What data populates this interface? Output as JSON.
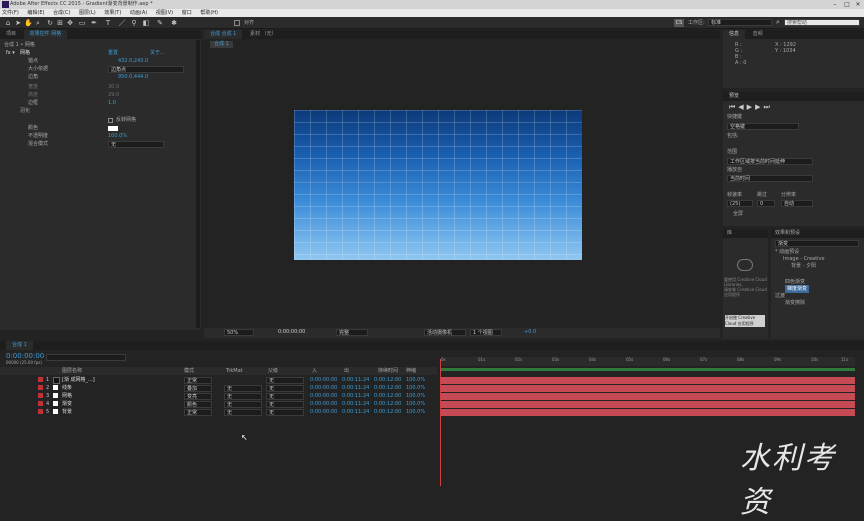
{
  "titlebar": {
    "title": "Adobe After Effects CC 2015 - Gradient渐变背景制作.aep *"
  },
  "menu": [
    "文件(F)",
    "编辑(E)",
    "合成(C)",
    "图层(L)",
    "效果(T)",
    "动画(A)",
    "视图(V)",
    "窗口",
    "帮助(H)"
  ],
  "toolbar": {
    "snap_label": "对齐",
    "workspace_label": "工作区:",
    "workspace_value": "标准",
    "search_placeholder": "搜索帮助"
  },
  "project_tabs": {
    "project": "项目",
    "effects": "效果控件 网格"
  },
  "effects": {
    "header": "合成 1 • 网格",
    "fx_name": "网格",
    "reset": "重置",
    "about": "关于...",
    "rows": [
      {
        "label": "锚点",
        "value": "432.0,243.0"
      },
      {
        "label": "大小依据",
        "value": "边角点"
      },
      {
        "label": "边角",
        "value": "950.0,444.0"
      },
      {
        "label": "宽度",
        "value": "30.0"
      },
      {
        "label": "高度",
        "value": "29.0"
      },
      {
        "label": "边框",
        "value": "1.0"
      },
      {
        "label": "羽化",
        "value": ""
      },
      {
        "label": "",
        "value": "反转网格"
      },
      {
        "label": "颜色",
        "value": ""
      },
      {
        "label": "不透明度",
        "value": "100.0%"
      },
      {
        "label": "混合模式",
        "value": "无"
      }
    ]
  },
  "comp": {
    "tabs": [
      "合成 合成 1",
      "素材 （无）"
    ],
    "breadcrumb": "合成 1",
    "zoom": "50%",
    "timecode": "0:00:00:00",
    "res": "完整",
    "camera": "活动摄像机",
    "view": "1 个视图",
    "exposure": "+0.0"
  },
  "info": {
    "tab1": "信息",
    "tab2": "音频",
    "lines": [
      "R :",
      "G :",
      "B :",
      "A : 0"
    ],
    "coords": [
      "X : 1292",
      "Y : 1034"
    ]
  },
  "preview": {
    "title": "预览",
    "shortcut_label": "快捷键",
    "shortcut_value": "空格键",
    "range_label": "包括:",
    "playmode_label": "范围",
    "playmode_value": "工作区域按当前时间延伸",
    "playfrom_label": "播放自",
    "playfrom_value": "当前时间",
    "fps_label": "帧速率",
    "skip_label": "跳过",
    "res_label": "分辨率",
    "fps_value": "(25)",
    "skip_value": "0",
    "res_value": "自动",
    "fullscreen": "全屏",
    "fx_label": "在回放后将时间设置为预览时间"
  },
  "library": {
    "tab": "库",
    "cc1": "要使用 Creative Cloud Libraries,",
    "cc2": "请安装 Creative Cloud 应用程序",
    "btn1": "开启使 Creative Cloud 应用程序"
  },
  "effects_presets": {
    "title": "效果和预设",
    "search": "渐变",
    "items": [
      "* 动画预设",
      "Image - Creative",
      "背景 - 夕阳",
      "四色渐变",
      "梯度渐变",
      "过渡",
      "渐变擦除"
    ]
  },
  "timeline": {
    "tab": "合成 1",
    "timecode": "0:00:00:00",
    "fps": "00000 (25.00 fps)",
    "headers": {
      "name": "图层名称",
      "mode": "模式",
      "trkmat": "TrkMat",
      "parent": "父级",
      "in": "入",
      "out": "出",
      "duration": "持续时间",
      "stretch": "伸缩"
    },
    "layers": [
      {
        "num": "1",
        "name": "[渐 成网格_...]",
        "mode": "正常",
        "trk": "",
        "parent": "无",
        "in": "0:00:00:00",
        "out": "0:00:11:24",
        "dur": "0:00:12:00",
        "stretch": "100.0%"
      },
      {
        "num": "2",
        "name": "线条",
        "mode": "叠加",
        "trk": "无",
        "parent": "无",
        "in": "0:00:00:00",
        "out": "0:00:11:24",
        "dur": "0:00:12:00",
        "stretch": "100.0%"
      },
      {
        "num": "3",
        "name": "网格",
        "mode": "变亮",
        "trk": "无",
        "parent": "无",
        "in": "0:00:00:00",
        "out": "0:00:11:24",
        "dur": "0:00:12:00",
        "stretch": "100.0%"
      },
      {
        "num": "4",
        "name": "渐变",
        "mode": "颜色",
        "trk": "无",
        "parent": "无",
        "in": "0:00:00:00",
        "out": "0:00:11:24",
        "dur": "0:00:12:00",
        "stretch": "100.0%"
      },
      {
        "num": "5",
        "name": "背景",
        "mode": "正常",
        "trk": "无",
        "parent": "无",
        "in": "0:00:00:00",
        "out": "0:00:11:24",
        "dur": "0:00:12:00",
        "stretch": "100.0%"
      }
    ],
    "ruler": [
      "0s",
      "01s",
      "02s",
      "03s",
      "04s",
      "05s",
      "06s",
      "07s",
      "08s",
      "09s",
      "10s",
      "11s"
    ]
  },
  "watermark": "水利考资",
  "colors": {
    "accent": "#3d9cd6",
    "layer_bar": "#c64a55",
    "label_red": "#c0323b"
  }
}
